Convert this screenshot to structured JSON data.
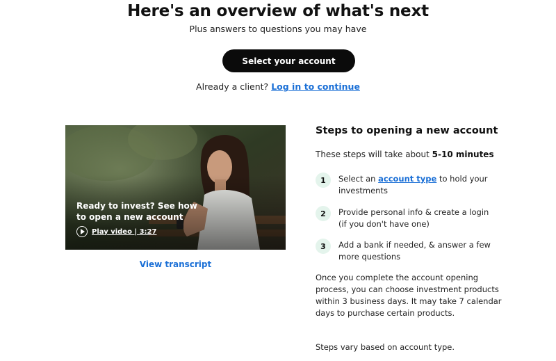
{
  "header": {
    "title": "Here's an overview of what's next",
    "subtitle": "Plus answers to questions you may have",
    "select_button": "Select your account",
    "client_prompt": "Already a client?",
    "login_link": "Log in to continue"
  },
  "video": {
    "caption": "Ready to invest? See how to open a new account",
    "play_label": "Play video | 3:27",
    "transcript_link": "View transcript"
  },
  "steps": {
    "title": "Steps to opening a new account",
    "intro_prefix": "These steps will take about",
    "intro_duration": "5-10 minutes",
    "items": [
      {
        "number": "1",
        "text_before": "Select an",
        "link": "account type",
        "text_after": "to hold your investments"
      },
      {
        "number": "2",
        "text": "Provide personal info & create a login (if you don't have one)"
      },
      {
        "number": "3",
        "text": "Add a bank if needed, & answer a few more questions"
      }
    ],
    "completion_note": "Once you complete the account opening process, you can choose investment products within 3 business days. It may take 7 calendar days to purchase certain products.",
    "vary_note": "Steps vary based on account type."
  },
  "colors": {
    "link": "#1a6fd6",
    "button_bg": "#0b0b0b",
    "step_badge_bg": "#e4f4ec"
  }
}
